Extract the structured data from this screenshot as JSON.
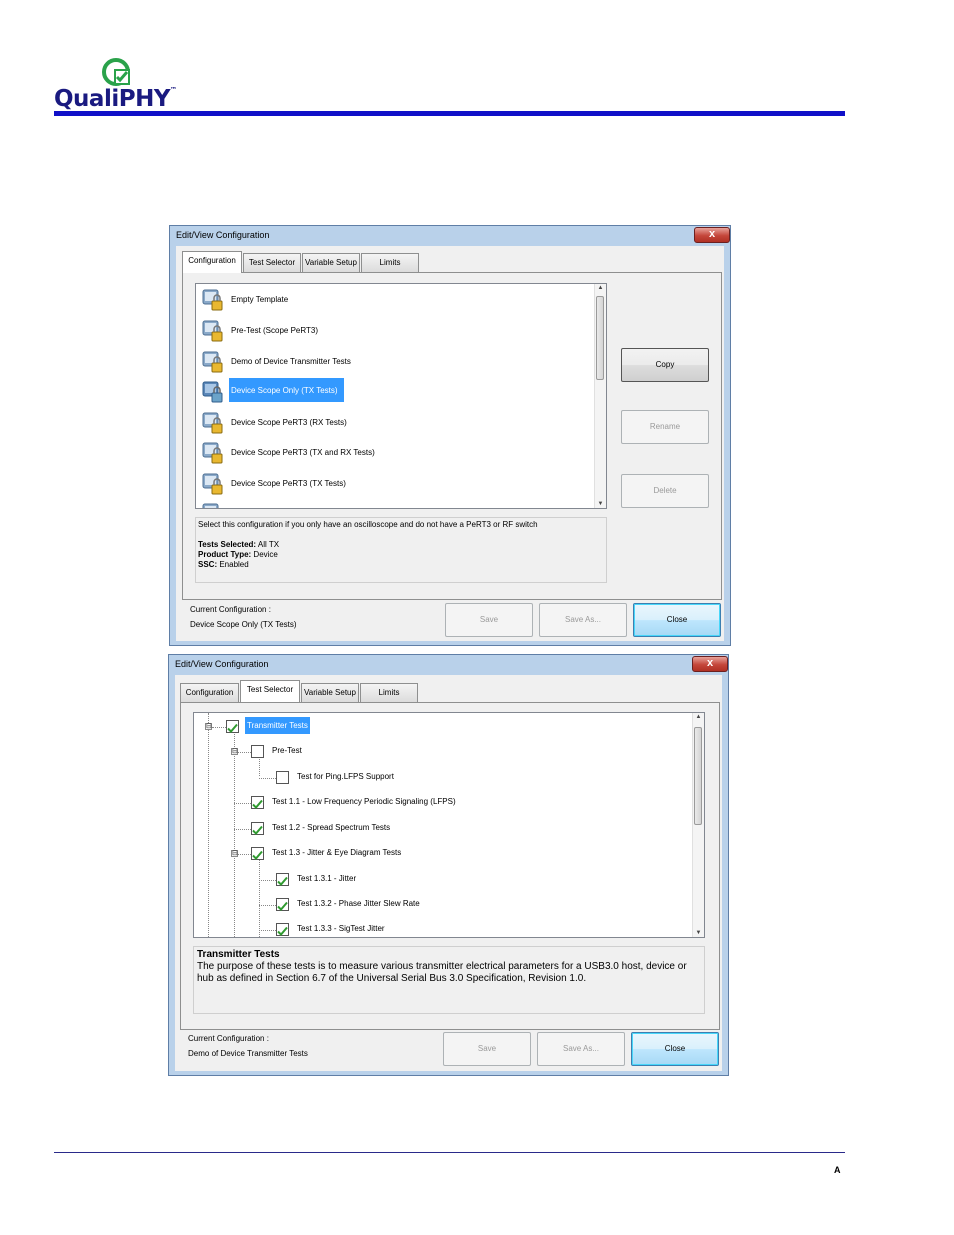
{
  "brand": {
    "name": "QualiPHY",
    "tm": "™",
    "mark_color": "#2aa24a",
    "rule_color": "#1010c8"
  },
  "page_letter": "A",
  "dialog1": {
    "title": "Edit/View Configuration",
    "close_glyph": "x",
    "tabs": [
      "Configuration",
      "Test Selector",
      "Variable Setup",
      "Limits"
    ],
    "active_tab": "Configuration",
    "configurations": [
      "Empty Template",
      "Pre-Test (Scope PeRT3)",
      "Demo of Device Transmitter Tests",
      "Device Scope Only (TX Tests)",
      "Device Scope PeRT3 (RX Tests)",
      "Device Scope PeRT3 (TX and RX Tests)",
      "Device Scope PeRT3 (TX Tests)"
    ],
    "selected": "Device Scope Only (TX Tests)",
    "description": "Select this configuration if you only have an oscilloscope and do not have a PeRT3 or RF switch",
    "details": [
      {
        "label": "Tests Selected:",
        "value": " All TX"
      },
      {
        "label": "Product Type:",
        "value": " Device"
      },
      {
        "label": "SSC:",
        "value": " Enabled"
      }
    ],
    "buttons": {
      "copy": "Copy",
      "rename": "Rename",
      "delete": "Delete"
    },
    "current_label": "Current Configuration :",
    "current_value": "Device Scope Only (TX Tests)",
    "footer_buttons": {
      "save": "Save",
      "save_as": "Save As...",
      "close": "Close"
    }
  },
  "dialog2": {
    "title": "Edit/View Configuration",
    "close_glyph": "x",
    "tabs": [
      "Configuration",
      "Test Selector",
      "Variable Setup",
      "Limits"
    ],
    "active_tab": "Test Selector",
    "tree": [
      {
        "label": "Transmitter Tests",
        "checked": true,
        "level": 0,
        "expander": "⊟",
        "selected": true
      },
      {
        "label": "Pre-Test",
        "checked": false,
        "level": 1,
        "expander": "⊟",
        "selected": false
      },
      {
        "label": "Test for Ping.LFPS Support",
        "checked": false,
        "level": 2,
        "expander": "",
        "selected": false
      },
      {
        "label": "Test 1.1 - Low Frequency Periodic Signaling (LFPS)",
        "checked": true,
        "level": 1,
        "expander": "",
        "selected": false
      },
      {
        "label": "Test 1.2 - Spread Spectrum Tests",
        "checked": true,
        "level": 1,
        "expander": "",
        "selected": false
      },
      {
        "label": "Test 1.3 - Jitter & Eye Diagram Tests",
        "checked": true,
        "level": 1,
        "expander": "⊟",
        "selected": false
      },
      {
        "label": "Test 1.3.1 - Jitter",
        "checked": true,
        "level": 2,
        "expander": "",
        "selected": false
      },
      {
        "label": "Test 1.3.2 - Phase Jitter Slew Rate",
        "checked": true,
        "level": 2,
        "expander": "",
        "selected": false
      },
      {
        "label": "Test 1.3.3 - SigTest Jitter",
        "checked": true,
        "level": 2,
        "expander": "",
        "selected": false
      }
    ],
    "desc_title": "Transmitter Tests",
    "desc_text": "The purpose of these tests is to measure various transmitter electrical parameters for a USB3.0 host, device or hub as defined in Section 6.7 of the Universal Serial Bus 3.0 Specification, Revision 1.0.",
    "current_label": "Current Configuration :",
    "current_value": "Demo of Device Transmitter Tests",
    "footer_buttons": {
      "save": "Save",
      "save_as": "Save As...",
      "close": "Close"
    }
  }
}
